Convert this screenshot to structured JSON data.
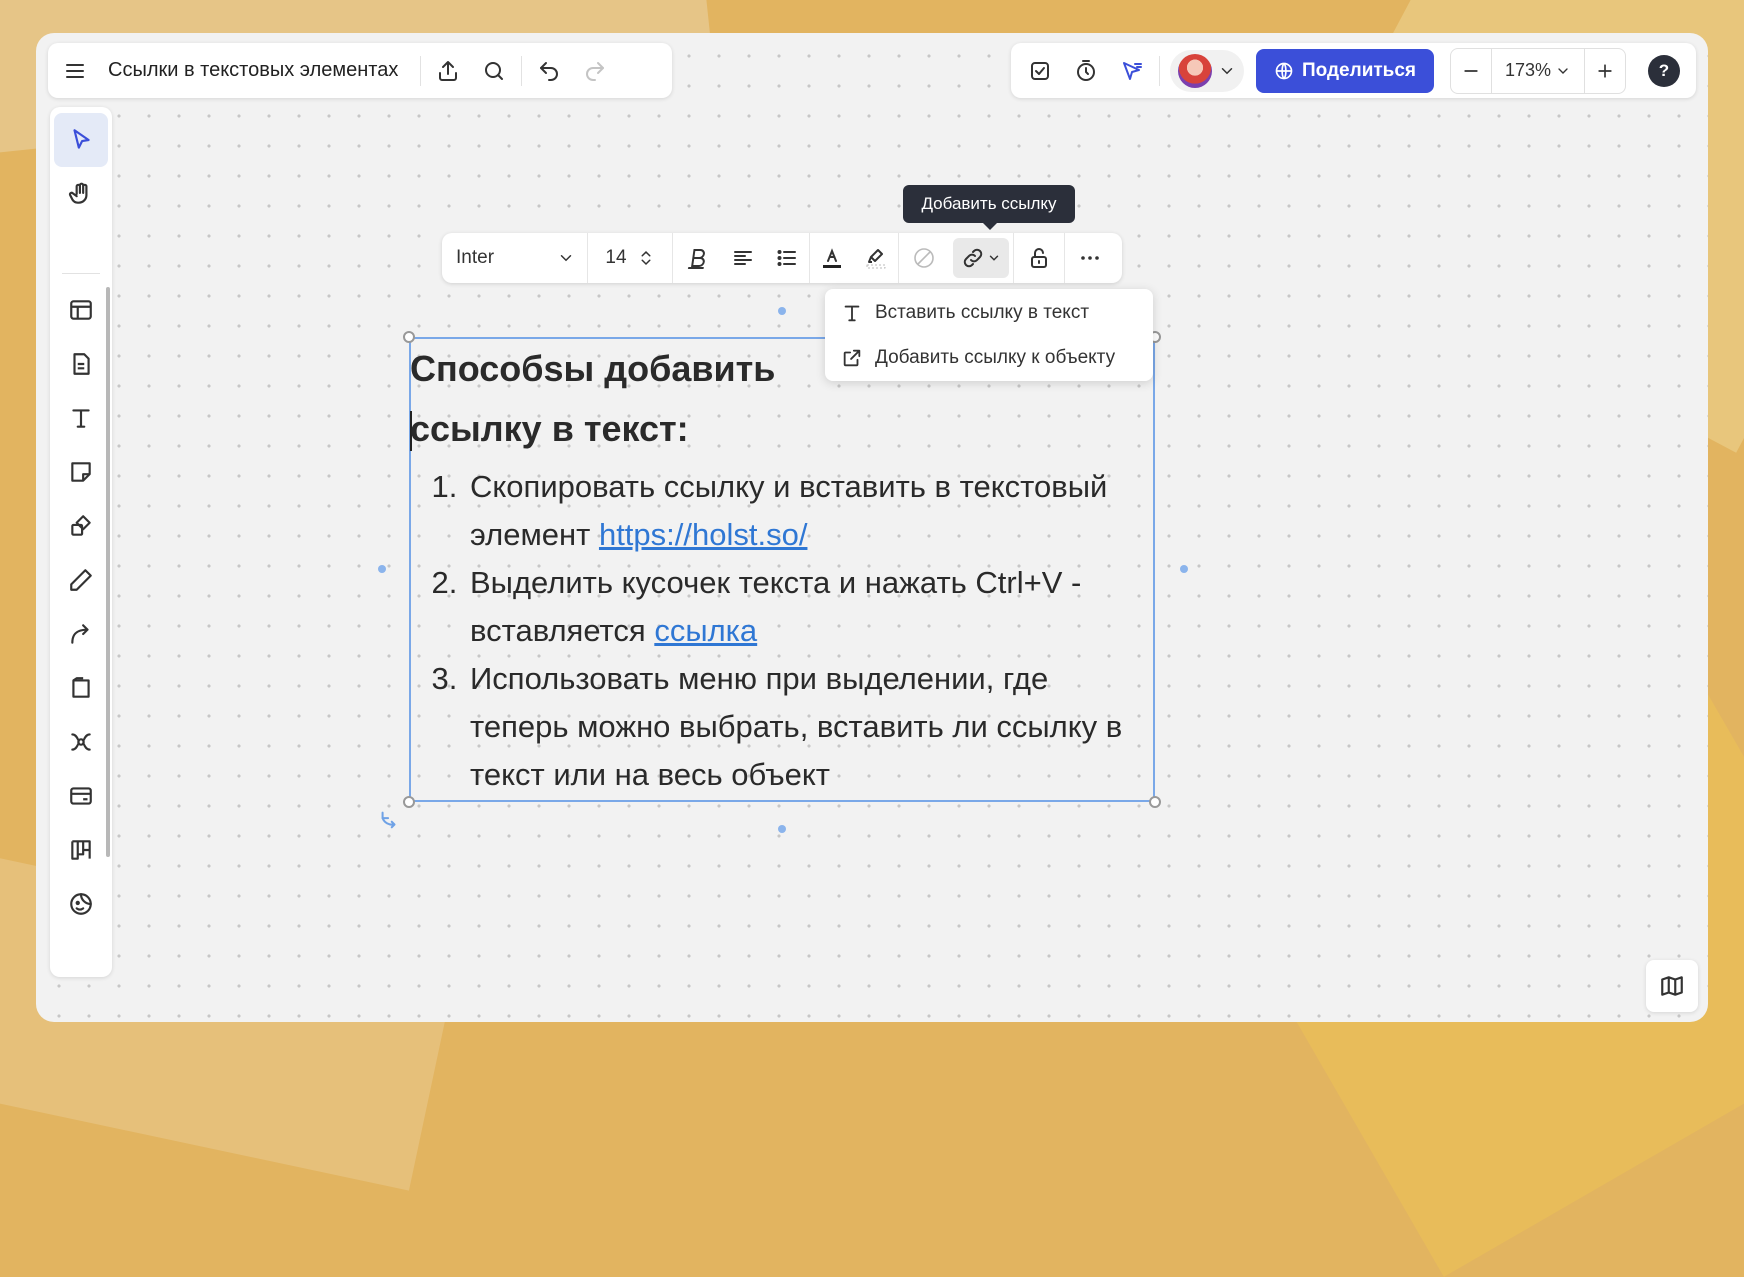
{
  "header": {
    "menu_icon": "hamburger-icon",
    "title": "Ссылки в текстовых элементах",
    "share_label": "Поделиться",
    "zoom_value": "173%",
    "help_label": "?"
  },
  "format_bar": {
    "font": "Inter",
    "size": "14",
    "tooltip": "Добавить ссылку"
  },
  "link_menu": {
    "items": [
      {
        "label": "Вставить ссылку в текст",
        "icon": "text-t-icon"
      },
      {
        "label": "Добавить ссылку к объекту",
        "icon": "external-link-icon"
      }
    ]
  },
  "text_element": {
    "heading_line1": "Способsы добавить",
    "heading_line2": "ссылку в текст:",
    "items": [
      {
        "text": "Скопировать ссылку и вставить в текстовый элемент ",
        "link": "https://holst.so/"
      },
      {
        "text": "Выделить кусочек текста и нажать Ctrl+V - вставляется ",
        "link": "ссылка"
      },
      {
        "text": "Использовать меню при выделении, где теперь можно выбрать, вставить ли ссылку в текст или на весь объект",
        "link": ""
      }
    ]
  },
  "colors": {
    "accent": "#3b4fd9",
    "link": "#2f77d4",
    "selection": "#7aa8e8",
    "background": "#e2b460"
  }
}
